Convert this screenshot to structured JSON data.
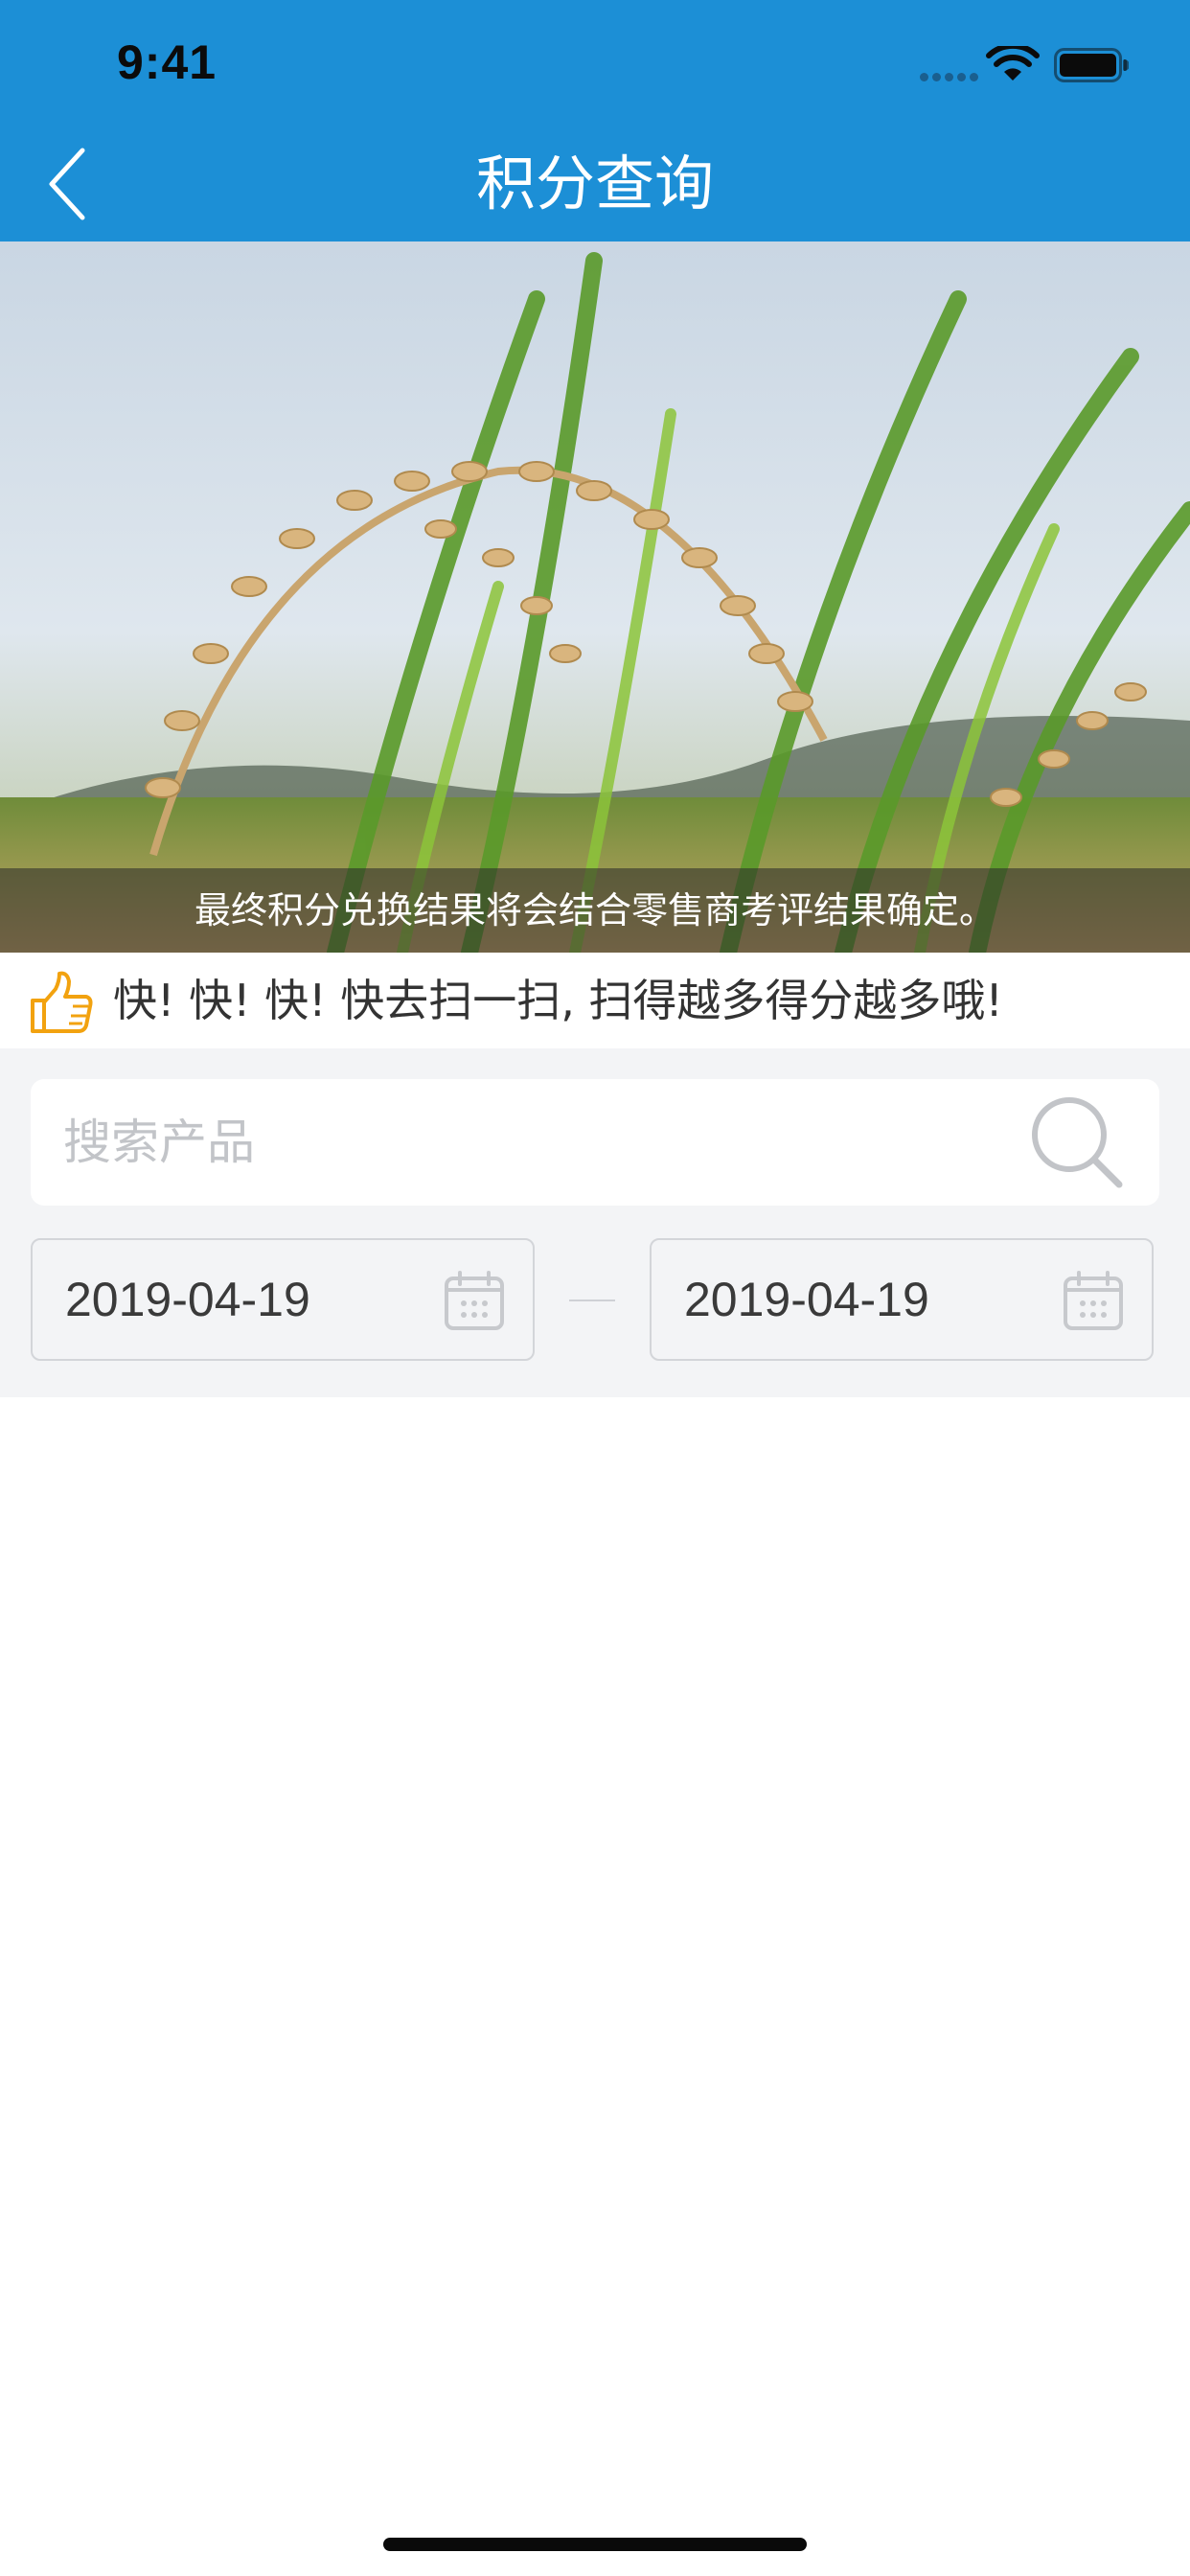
{
  "status_bar": {
    "time": "9:41"
  },
  "nav": {
    "title": "积分查询",
    "back_icon": "chevron-left-icon"
  },
  "banner": {
    "caption": "最终积分兑换结果将会结合零售商考评结果确定。"
  },
  "promo": {
    "icon": "thumbs-up-icon",
    "text": "快! 快! 快! 快去扫一扫, 扫得越多得分越多哦!"
  },
  "search": {
    "placeholder": "搜索产品",
    "value": "",
    "icon": "search-icon"
  },
  "date_range": {
    "start": "2019-04-19",
    "end": "2019-04-19",
    "icon": "calendar-icon"
  },
  "colors": {
    "header_bg": "#1c8fd6",
    "panel_bg": "#f3f4f6",
    "thumb_accent": "#f2a20f"
  }
}
